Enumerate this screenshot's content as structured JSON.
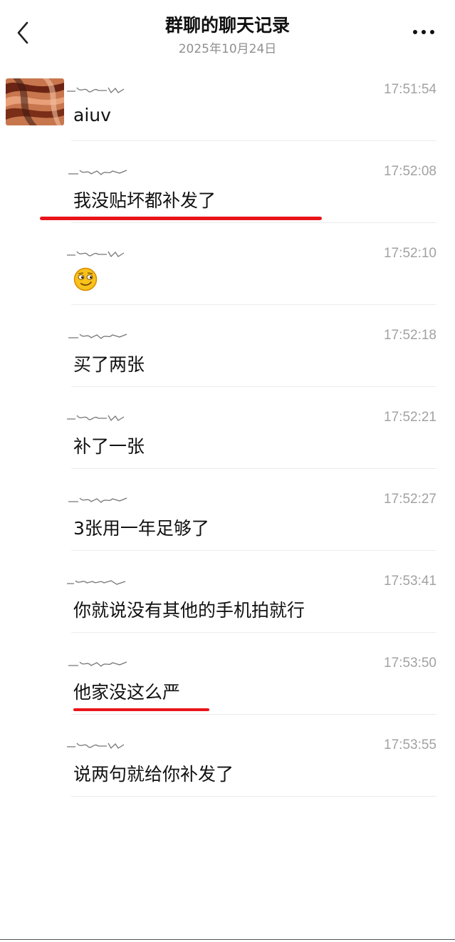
{
  "header": {
    "title": "群聊的聊天记录",
    "date": "2025年10月24日"
  },
  "messages": [
    {
      "time": "17:51:54",
      "text": "aiuv"
    },
    {
      "time": "17:52:08",
      "text": "我没贴坏都补发了"
    },
    {
      "time": "17:52:10",
      "text": "",
      "emoji": "smirk-emoji"
    },
    {
      "time": "17:52:18",
      "text": "买了两张"
    },
    {
      "time": "17:52:21",
      "text": "补了一张"
    },
    {
      "time": "17:52:27",
      "text": "3张用一年足够了"
    },
    {
      "time": "17:53:41",
      "text": "你就说没有其他的手机拍就行"
    },
    {
      "time": "17:53:50",
      "text": "他家没这么严"
    },
    {
      "time": "17:53:55",
      "text": "说两句就给你补发了"
    }
  ],
  "icons": {
    "back": "chevron-left-icon",
    "more": "more-dots-icon"
  },
  "colors": {
    "highlight": "#e8141a",
    "time": "#a2a2a2",
    "divider": "#ececec"
  }
}
